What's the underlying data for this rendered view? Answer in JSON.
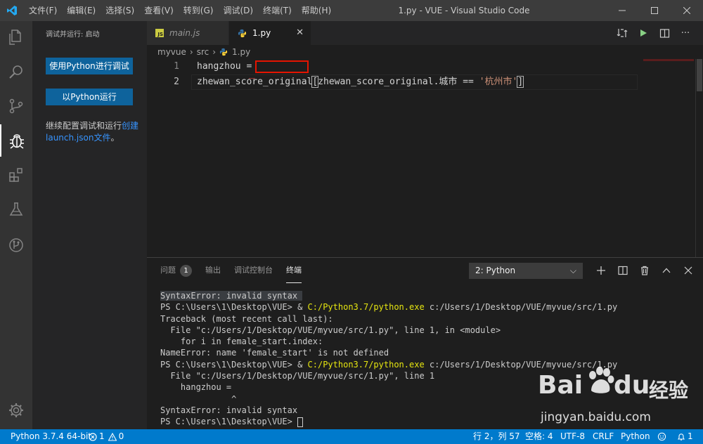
{
  "titlebar": {
    "menus": [
      "文件(F)",
      "编辑(E)",
      "选择(S)",
      "查看(V)",
      "转到(G)",
      "调试(D)",
      "终端(T)",
      "帮助(H)"
    ],
    "title": "1.py - VUE - Visual Studio Code"
  },
  "sidebar": {
    "title": "调试并运行: 启动",
    "debug_button": "使用Python进行调试",
    "run_button": "以Python运行",
    "text_prefix": "继续配置调试和运行",
    "link_text": "创建launch.json文件",
    "text_suffix": "。"
  },
  "tabs": [
    {
      "label": "main.js",
      "icon": "js-file-icon",
      "active": false
    },
    {
      "label": "1.py",
      "icon": "python-file-icon",
      "active": true
    }
  ],
  "breadcrumb": [
    "myvue",
    "src",
    "1.py"
  ],
  "editor": {
    "lines": [
      {
        "number": "1",
        "text": "hangzhou ="
      },
      {
        "number": "2",
        "parts": [
          "zhewan_score_original",
          "[",
          "zhewan_score_original.城市 == ",
          "'杭州市'",
          "]"
        ]
      }
    ]
  },
  "panel": {
    "tabs": [
      "问题",
      "输出",
      "调试控制台",
      "终端"
    ],
    "problems_count": "1",
    "active_tab": "终端",
    "terminal_select": "2: Python",
    "terminal_lines": [
      {
        "text": "SyntaxError: invalid syntax ",
        "highlight": true
      },
      {
        "pre": "PS C:\\Users\\1\\Desktop\\VUE> & ",
        "exe": "C:/Python3.7/python.exe",
        "post": " c:/Users/1/Desktop/VUE/myvue/src/1.py"
      },
      {
        "text": "Traceback (most recent call last):"
      },
      {
        "text": "  File \"c:/Users/1/Desktop/VUE/myvue/src/1.py\", line 1, in <module>"
      },
      {
        "text": "    for i in female_start.index:"
      },
      {
        "text": "NameError: name 'female_start' is not defined"
      },
      {
        "pre": "PS C:\\Users\\1\\Desktop\\VUE> & ",
        "exe": "C:/Python3.7/python.exe",
        "post": " c:/Users/1/Desktop/VUE/myvue/src/1.py"
      },
      {
        "text": "  File \"c:/Users/1/Desktop/VUE/myvue/src/1.py\", line 1"
      },
      {
        "text": "    hangzhou ="
      },
      {
        "text": "              ^"
      },
      {
        "text": "SyntaxError: invalid syntax"
      },
      {
        "text": "PS C:\\Users\\1\\Desktop\\VUE> ",
        "cursor": true
      }
    ]
  },
  "statusbar": {
    "interpreter": "Python 3.7.4 64-bit",
    "errors": "1",
    "warnings": "0",
    "position": "行 2，列 57",
    "spaces": "空格: 4",
    "encoding": "UTF-8",
    "eol": "CRLF",
    "language": "Python",
    "notifications": "1"
  },
  "watermark": {
    "brand": "Bai",
    "brand2": "du",
    "cn": "经验",
    "url": "jingyan.baidu.com"
  },
  "colors": {
    "accent": "#007acc",
    "button": "#0e639c",
    "error_box": "#e51400",
    "string": "#ce9178",
    "exe_yellow": "#e5e510"
  }
}
